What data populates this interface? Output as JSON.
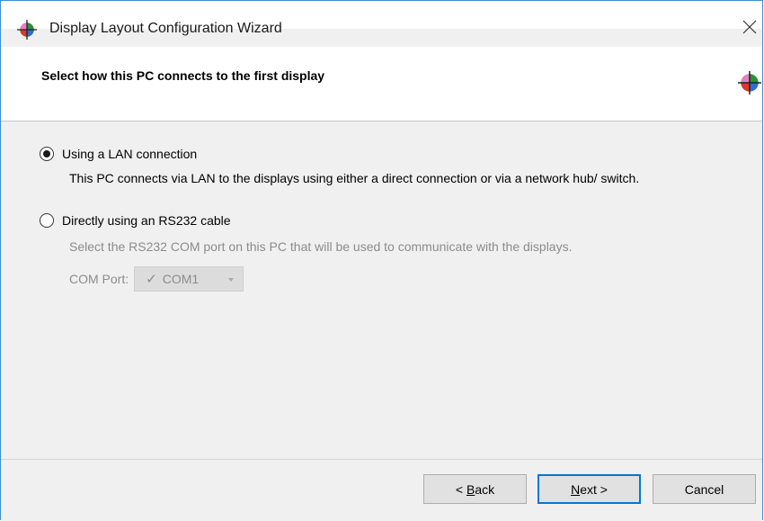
{
  "window": {
    "title": "Display Layout Configuration Wizard",
    "icon": "app-color-wheel-icon",
    "close_icon": "close-icon"
  },
  "header": {
    "title": "Select how this PC connects to the first display",
    "icon": "app-color-wheel-icon"
  },
  "options": [
    {
      "label": "Using a LAN connection",
      "selected": true,
      "description": "This PC connects via LAN to the displays using either a direct connection or via a network hub/ switch."
    },
    {
      "label": "Directly using an RS232 cable",
      "selected": false,
      "description": "Select the RS232 COM port on this PC that will be used to communicate with the displays."
    }
  ],
  "com_port": {
    "label": "COM Port:",
    "selected": "COM1",
    "check": "✓",
    "enabled": false
  },
  "buttons": {
    "back_mnemonic": "B",
    "back_rest": "ack",
    "back_prefix": "< ",
    "next_mnemonic": "N",
    "next_rest": "ext >",
    "cancel": "Cancel"
  },
  "colors": {
    "window_border": "#3a8fd6",
    "default_button_border": "#0078d7",
    "disabled_text": "#8c8c8c"
  }
}
